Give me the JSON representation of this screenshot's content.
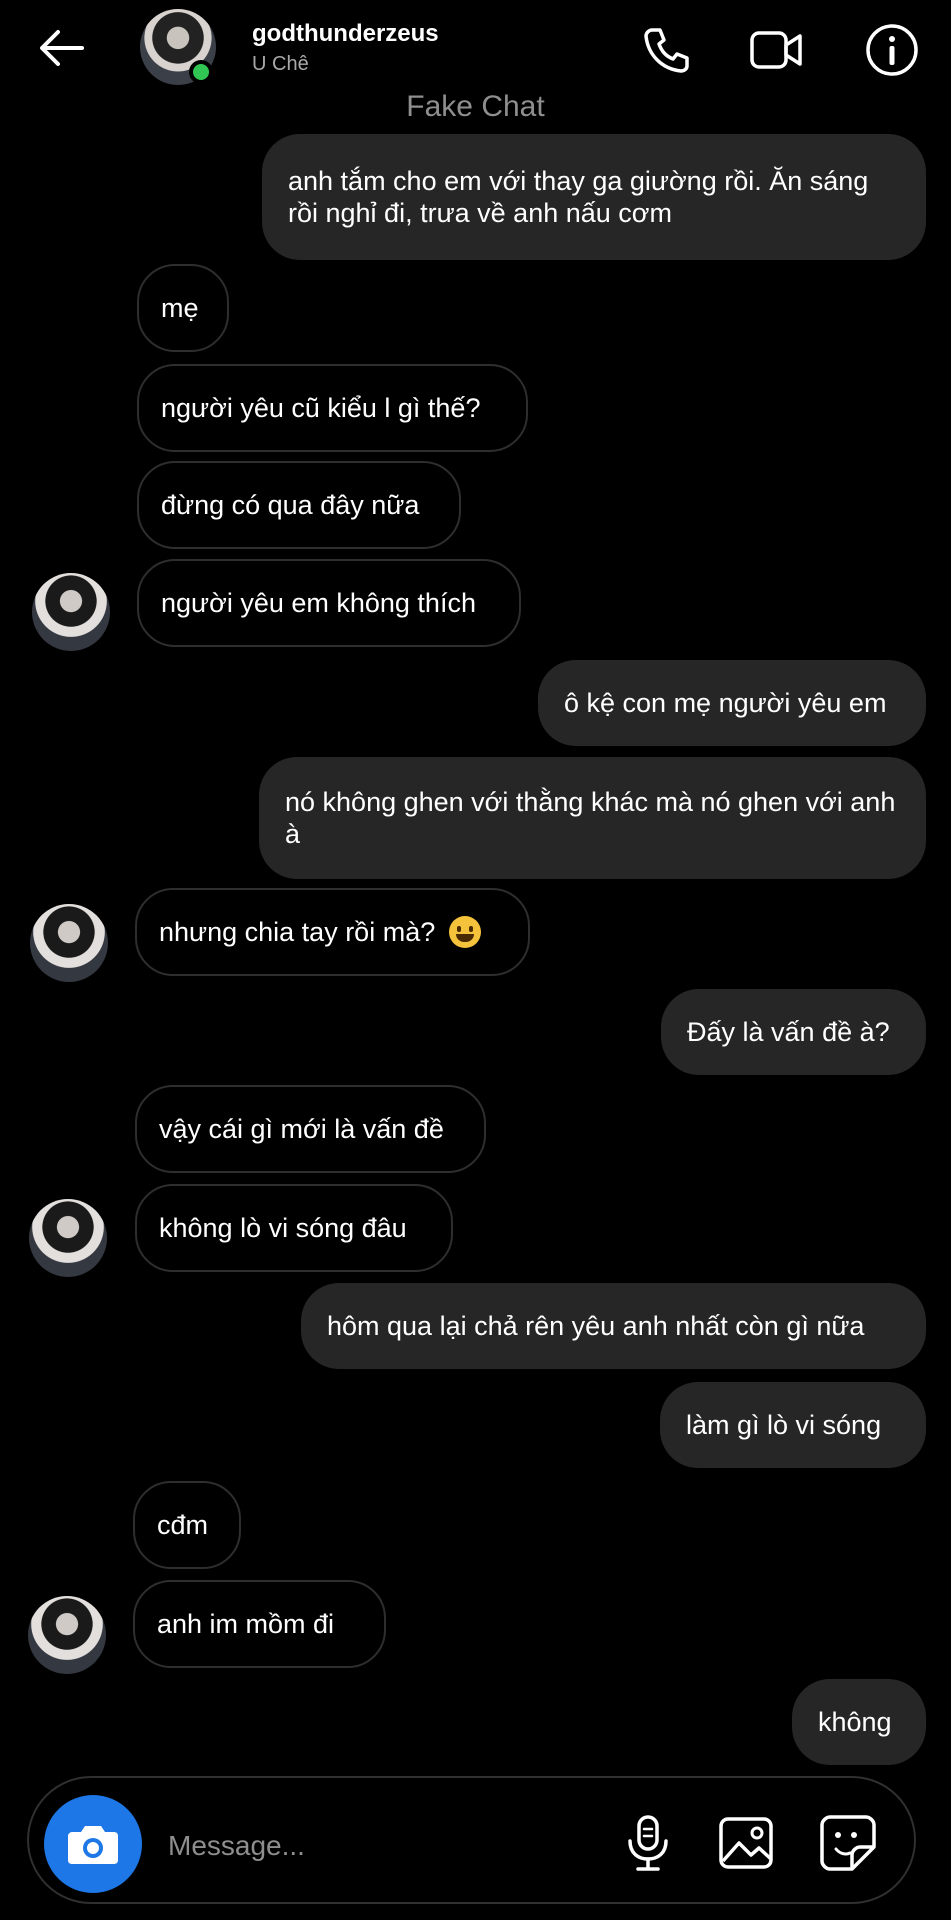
{
  "header": {
    "username": "godthunderzeus",
    "subtitle": "U Chê",
    "title_label": "Fake Chat",
    "icons": [
      "back-arrow-icon",
      "phone-icon",
      "video-camera-icon",
      "info-icon"
    ],
    "online_status_color": "#31c653"
  },
  "messages": [
    {
      "side": "sent",
      "text": "anh tắm cho em với thay ga giường rồi. Ăn sáng rồi nghỉ đi, trưa về anh nấu cơm"
    },
    {
      "side": "received",
      "text": "mẹ"
    },
    {
      "side": "received",
      "text": "người yêu cũ kiểu l gì thế?"
    },
    {
      "side": "received",
      "text": "đừng có qua đây nữa"
    },
    {
      "side": "received",
      "text": "người yêu em không thích"
    },
    {
      "side": "sent",
      "text": "ô kệ con mẹ người yêu em"
    },
    {
      "side": "sent",
      "text": "nó không ghen với thằng khác mà nó ghen với anh à"
    },
    {
      "side": "received",
      "text": "nhưng chia tay rồi mà?",
      "emoji": "grinning-face"
    },
    {
      "side": "sent",
      "text": "Đấy là vấn đề à?"
    },
    {
      "side": "received",
      "text": "vậy cái gì mới là vấn đề"
    },
    {
      "side": "received",
      "text": "không lò vi sóng đâu"
    },
    {
      "side": "sent",
      "text": "hôm qua lại chả rên yêu anh nhất còn gì nữa"
    },
    {
      "side": "sent",
      "text": "làm gì lò vi sóng"
    },
    {
      "side": "received",
      "text": "cđm"
    },
    {
      "side": "received",
      "text": "anh im mồm đi"
    },
    {
      "side": "sent",
      "text": "không"
    }
  ],
  "composer": {
    "placeholder": "Message...",
    "icons": [
      "camera-icon",
      "microphone-icon",
      "gallery-icon",
      "sticker-icon"
    ],
    "camera_button_color": "#1d77e6"
  },
  "colors": {
    "background": "#000000",
    "sent_bubble": "#262626",
    "received_border": "#2e2e2e"
  }
}
